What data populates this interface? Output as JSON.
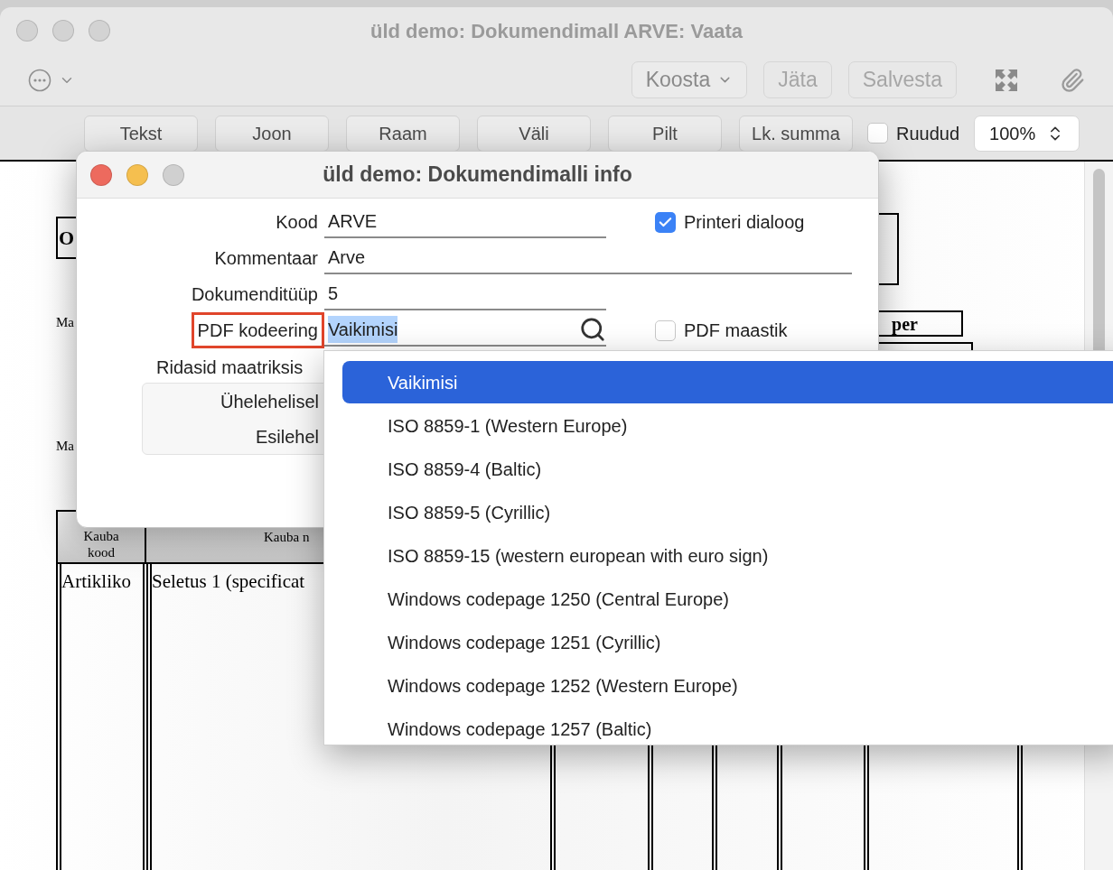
{
  "main_window": {
    "title": "üld demo: Dokumendimall ARVE: Vaata",
    "toolbar_buttons": [
      {
        "label": "Koosta",
        "kind": "dropdown",
        "disabled": false
      },
      {
        "label": "Jäta",
        "kind": "plain",
        "disabled": true
      },
      {
        "label": "Salvesta",
        "kind": "plain",
        "disabled": true
      }
    ],
    "insert_buttons": [
      "Tekst",
      "Joon",
      "Raam",
      "Väli",
      "Pilt",
      "Lk. summa"
    ],
    "grid_checkbox": {
      "label": "Ruudud",
      "checked": false
    },
    "zoom": "100%"
  },
  "document": {
    "heading": "O",
    "left_labels": [
      "Ma",
      "Ma"
    ],
    "right_box": "per",
    "table": {
      "columns": [
        "Kauba\nkood",
        "Kauba n"
      ],
      "row": [
        "Artikliko",
        "Seletus 1 (specificat"
      ]
    }
  },
  "dialog": {
    "title": "üld demo: Dokumendimalli info",
    "fields": [
      {
        "label": "Kood",
        "value": "ARVE",
        "kind": "text",
        "marked": false,
        "value_selected": false,
        "side_checkbox": {
          "label": "Printeri dialoog",
          "checked": true
        }
      },
      {
        "label": "Kommentaar",
        "value": "Arve",
        "kind": "wide",
        "marked": false,
        "value_selected": false
      },
      {
        "label": "Dokumenditüüp",
        "value": "5",
        "kind": "text",
        "marked": false,
        "value_selected": false
      },
      {
        "label": "PDF kodeering",
        "value": "Vaikimisi",
        "kind": "lookup",
        "marked": true,
        "value_selected": true,
        "side_checkbox": {
          "label": "PDF maastik",
          "checked": false
        }
      }
    ],
    "matrix_label": "Ridasid maatriksis",
    "matrix_options": [
      "Ühelehelisel",
      "Esilehel"
    ]
  },
  "dropdown": {
    "items": [
      {
        "label": "Vaikimisi",
        "selected": true
      },
      {
        "label": "ISO 8859-1 (Western Europe)",
        "selected": false
      },
      {
        "label": "ISO 8859-4 (Baltic)",
        "selected": false
      },
      {
        "label": "ISO 8859-5 (Cyrillic)",
        "selected": false
      },
      {
        "label": "ISO 8859-15 (western european with euro sign)",
        "selected": false
      },
      {
        "label": "Windows codepage 1250 (Central Europe)",
        "selected": false
      },
      {
        "label": "Windows codepage 1251 (Cyrillic)",
        "selected": false
      },
      {
        "label": "Windows codepage 1252 (Western Europe)",
        "selected": false
      },
      {
        "label": "Windows codepage 1257 (Baltic)",
        "selected": false
      }
    ]
  }
}
